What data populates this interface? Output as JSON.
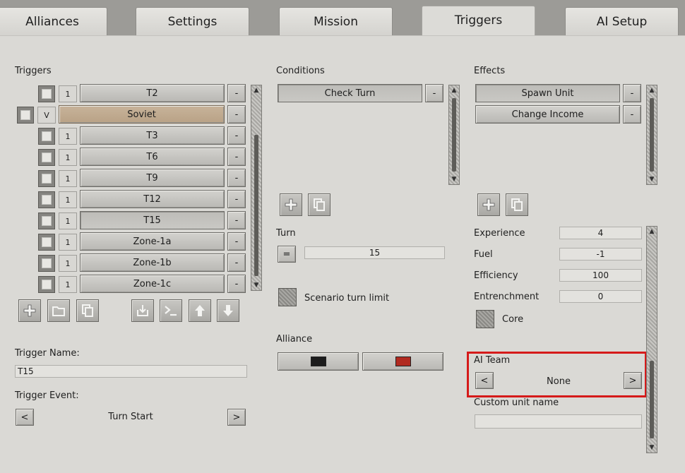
{
  "tabs": [
    "Alliances",
    "Settings",
    "Mission",
    "Triggers",
    "AI Setup"
  ],
  "active_tab": "Triggers",
  "triggers": {
    "header": "Triggers",
    "rows": [
      {
        "num": "1",
        "name": "T2",
        "remove": "-"
      },
      {
        "num": "V",
        "name": "Soviet",
        "remove": "-"
      },
      {
        "num": "1",
        "name": "T3",
        "remove": "-"
      },
      {
        "num": "1",
        "name": "T6",
        "remove": "-"
      },
      {
        "num": "1",
        "name": "T9",
        "remove": "-"
      },
      {
        "num": "1",
        "name": "T12",
        "remove": "-"
      },
      {
        "num": "1",
        "name": "T15",
        "remove": "-"
      },
      {
        "num": "1",
        "name": "Zone-1a",
        "remove": "-"
      },
      {
        "num": "1",
        "name": "Zone-1b",
        "remove": "-"
      },
      {
        "num": "1",
        "name": "Zone-1c",
        "remove": "-"
      }
    ],
    "name_label": "Trigger Name:",
    "name_value": "T15",
    "event_label": "Trigger Event:",
    "event_value": "Turn Start",
    "prev": "<",
    "next": ">"
  },
  "conditions": {
    "header": "Conditions",
    "items": [
      {
        "name": "Check Turn",
        "remove": "-"
      }
    ],
    "turn_label": "Turn",
    "turn_op": "=",
    "turn_value": "15",
    "limit_label": "Scenario turn limit",
    "alliance_label": "Alliance",
    "alliance_colors": [
      "#1c1c1c",
      "#b12a20"
    ]
  },
  "effects": {
    "header": "Effects",
    "items": [
      {
        "name": "Spawn Unit",
        "remove": "-"
      },
      {
        "name": "Change Income",
        "remove": "-"
      }
    ],
    "props": [
      {
        "label": "Experience",
        "value": "4"
      },
      {
        "label": "Fuel",
        "value": "-1"
      },
      {
        "label": "Efficiency",
        "value": "100"
      },
      {
        "label": "Entrenchment",
        "value": "0"
      }
    ],
    "core_label": "Core",
    "ai_team_label": "AI Team",
    "ai_team_value": "None",
    "prev": "<",
    "next": ">",
    "custom_name_label": "Custom unit name",
    "custom_name_value": ""
  }
}
